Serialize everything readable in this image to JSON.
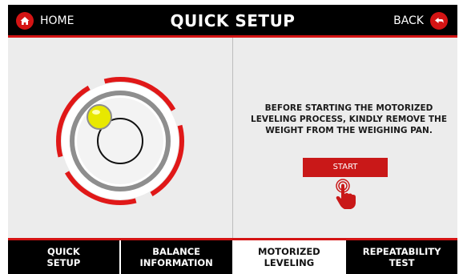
{
  "header": {
    "home_label": "HOME",
    "title": "QUICK SETUP",
    "back_label": "BACK"
  },
  "leveling": {
    "instruction": "BEFORE STARTING THE MOTORIZED LEVELING PROCESS, KINDLY REMOVE THE WEIGHT FROM THE WEIGHING PAN.",
    "start_label": "START"
  },
  "tabs": [
    {
      "label": "QUICK\nSETUP",
      "active": false
    },
    {
      "label": "BALANCE\nINFORMATION",
      "active": false
    },
    {
      "label": "MOTORIZED\nLEVELING",
      "active": true
    },
    {
      "label": "REPEATABILITY\nTEST",
      "active": false
    }
  ],
  "colors": {
    "accent": "#d41414",
    "bubble": "#e8e800",
    "background": "#ececec",
    "bar": "#000000"
  },
  "icons": {
    "home": "home-icon",
    "back": "back-arrow-icon",
    "tap": "hand-tap-icon",
    "level": "bubble-level-icon"
  }
}
